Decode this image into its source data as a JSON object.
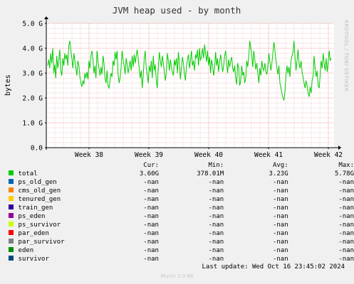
{
  "chart_data": {
    "type": "line",
    "title": "JVM heap used - by month",
    "ylabel": "bytes",
    "y_ticks": [
      "0.0",
      "1.0 G",
      "2.0 G",
      "3.0 G",
      "4.0 G",
      "5.0 G"
    ],
    "ylim": [
      0,
      5.0
    ],
    "y_unit": "G bytes",
    "x_ticks": [
      "Week 38",
      "Week 39",
      "Week 40",
      "Week 41",
      "Week 42"
    ],
    "grid": true,
    "side_label": "RRDTOOL / TOBI OETIKER",
    "series": [
      {
        "name": "total",
        "color": "#00cc00",
        "values": [
          3.3,
          3.55,
          3.2,
          3.8,
          3.4,
          4.0,
          3.0,
          3.35,
          2.8,
          3.7,
          3.2,
          3.5,
          3.95,
          3.1,
          2.9,
          3.6,
          3.3,
          3.8,
          3.55,
          3.75,
          3.3,
          4.1,
          4.3,
          3.9,
          3.6,
          3.2,
          3.8,
          3.5,
          3.2,
          2.9,
          3.5,
          3.3,
          2.85,
          2.6,
          2.45,
          2.7,
          2.55,
          3.0,
          2.8,
          3.05,
          2.75,
          3.5,
          3.2,
          3.7,
          3.9,
          3.55,
          3.0,
          3.3,
          2.8,
          3.9,
          3.45,
          3.2,
          2.9,
          3.25,
          2.95,
          3.7,
          3.4,
          2.8,
          2.6,
          3.1,
          2.5,
          2.4,
          2.7,
          3.0,
          2.85,
          3.5,
          3.3,
          3.85,
          3.55,
          3.9,
          2.95,
          2.6,
          2.8,
          3.2,
          3.9,
          3.55,
          3.3,
          2.95,
          3.6,
          3.35,
          3.0,
          3.25,
          3.5,
          3.1,
          3.7,
          3.25,
          3.75,
          3.4,
          3.7,
          3.95,
          3.6,
          3.2,
          2.8,
          3.1,
          2.4,
          2.9,
          3.6,
          3.9,
          3.2,
          2.95,
          2.6,
          3.3,
          3.05,
          3.5,
          2.8,
          3.7,
          3.1,
          3.35,
          2.7,
          2.4,
          3.2,
          3.85,
          3.5,
          3.25,
          3.7,
          3.4,
          3.05,
          2.7,
          3.0,
          3.8,
          3.5,
          3.1,
          3.55,
          3.25,
          3.05,
          2.9,
          3.55,
          3.3,
          3.6,
          3.0,
          3.85,
          3.35,
          2.75,
          3.2,
          3.65,
          3.4,
          3.0,
          2.7,
          3.3,
          3.55,
          3.75,
          3.2,
          3.5,
          3.9,
          3.3,
          3.5,
          3.1,
          3.75,
          3.6,
          3.95,
          3.3,
          4.0,
          3.5,
          3.7,
          4.0,
          3.6,
          4.15,
          3.8,
          3.45,
          3.9,
          3.3,
          3.65,
          3.0,
          3.55,
          3.3,
          2.9,
          3.2,
          3.85,
          3.3,
          3.6,
          3.05,
          3.45,
          3.75,
          3.4,
          3.05,
          3.3,
          3.7,
          3.9,
          3.4,
          3.0,
          3.55,
          3.25,
          3.5,
          3.65,
          3.2,
          3.05,
          3.3,
          2.8,
          2.55,
          3.4,
          3.2,
          2.5,
          2.7,
          3.3,
          2.9,
          3.05,
          2.6,
          2.8,
          3.5,
          3.25,
          3.7,
          4.3,
          4.0,
          3.7,
          3.25,
          3.9,
          3.55,
          3.15,
          3.4,
          3.0,
          2.6,
          3.2,
          2.9,
          3.5,
          3.2,
          3.1,
          3.4,
          3.05,
          2.95,
          3.3,
          3.8,
          3.45,
          3.1,
          3.4,
          3.8,
          4.25,
          3.9,
          3.5,
          3.2,
          2.95,
          3.3,
          2.6,
          2.4,
          2.2,
          2.0,
          1.9,
          2.3,
          2.9,
          3.3,
          3.0,
          3.25,
          2.85,
          3.5,
          3.7,
          3.85,
          4.3,
          3.6,
          3.1,
          3.5,
          3.95,
          3.4,
          3.2,
          3.5,
          3.05,
          2.85,
          2.6,
          2.4,
          2.7,
          2.5,
          2.2,
          2.05,
          2.45,
          2.2,
          2.7,
          2.9,
          3.7,
          3.2,
          2.85,
          3.1,
          2.5,
          2.4,
          2.9,
          3.5,
          3.2,
          3.8,
          3.4,
          3.1,
          3.6,
          3.05,
          3.45,
          3.9,
          3.5,
          3.6
        ]
      }
    ]
  },
  "legend": {
    "headers": {
      "cur": "Cur:",
      "min": "Min:",
      "avg": "Avg:",
      "max": "Max:"
    },
    "rows": [
      {
        "name": "total",
        "color": "#00cc00",
        "cur": "3.60G",
        "min": "378.01M",
        "avg": "3.23G",
        "max": "5.78G"
      },
      {
        "name": "ps_old_gen",
        "color": "#0066b3",
        "cur": "-nan",
        "min": "-nan",
        "avg": "-nan",
        "max": "-nan"
      },
      {
        "name": "cms_old_gen",
        "color": "#ff8000",
        "cur": "-nan",
        "min": "-nan",
        "avg": "-nan",
        "max": "-nan"
      },
      {
        "name": "tenured_gen",
        "color": "#ffcc00",
        "cur": "-nan",
        "min": "-nan",
        "avg": "-nan",
        "max": "-nan"
      },
      {
        "name": "train_gen",
        "color": "#330099",
        "cur": "-nan",
        "min": "-nan",
        "avg": "-nan",
        "max": "-nan"
      },
      {
        "name": "ps_eden",
        "color": "#990099",
        "cur": "-nan",
        "min": "-nan",
        "avg": "-nan",
        "max": "-nan"
      },
      {
        "name": "ps_survivor",
        "color": "#ccff00",
        "cur": "-nan",
        "min": "-nan",
        "avg": "-nan",
        "max": "-nan"
      },
      {
        "name": "par_eden",
        "color": "#ff0000",
        "cur": "-nan",
        "min": "-nan",
        "avg": "-nan",
        "max": "-nan"
      },
      {
        "name": "par_survivor",
        "color": "#808080",
        "cur": "-nan",
        "min": "-nan",
        "avg": "-nan",
        "max": "-nan"
      },
      {
        "name": "eden",
        "color": "#008f00",
        "cur": "-nan",
        "min": "-nan",
        "avg": "-nan",
        "max": "-nan"
      },
      {
        "name": "survivor",
        "color": "#00487d",
        "cur": "-nan",
        "min": "-nan",
        "avg": "-nan",
        "max": "-nan"
      }
    ]
  },
  "footer": {
    "last_update": "Last update: Wed Oct 16 23:45:02 2024",
    "version": "Munin 2.0.66"
  }
}
